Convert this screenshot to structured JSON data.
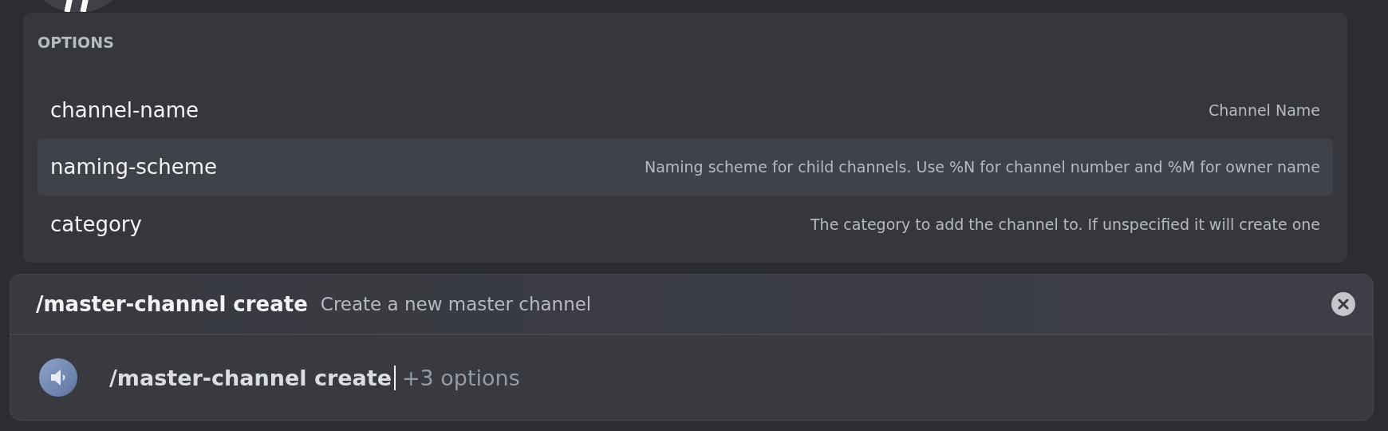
{
  "options_popup": {
    "heading": "OPTIONS",
    "options": [
      {
        "name": "channel-name",
        "description": "Channel Name",
        "selected": false
      },
      {
        "name": "naming-scheme",
        "description": "Naming scheme for child channels. Use %N for channel number and %M for owner name",
        "selected": true
      },
      {
        "name": "category",
        "description": "The category to add the channel to. If unspecified it will create one",
        "selected": false
      }
    ]
  },
  "command_bar": {
    "command": "/master-channel create",
    "description": "Create a new master channel",
    "input": {
      "value": "/master-channel create",
      "hint": "+3 options"
    }
  }
}
